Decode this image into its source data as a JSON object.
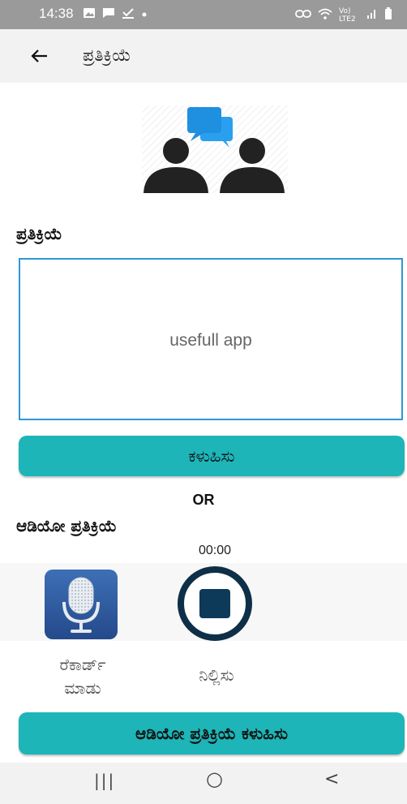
{
  "status_bar": {
    "time": "14:38",
    "left_icons": [
      "gallery-icon",
      "message-icon",
      "download-done-icon",
      "dot-icon"
    ],
    "right_icons": [
      "link-icon",
      "wifi-icon",
      "volte-signal-icon",
      "battery-icon"
    ],
    "network_label": "Vo) LTE2"
  },
  "appbar": {
    "title": "ಪ್ರತಿಕ್ರಿಯೆ"
  },
  "feedback": {
    "heading": "ಪ್ರತಿಕ್ರಿಯೆ",
    "text_value": "usefull app",
    "send_label": "ಕಳುಹಿಸು"
  },
  "or_label": "OR",
  "audio": {
    "heading": "ಆಡಿಯೋ ಪ್ರತಿಕ್ರಿಯೆ",
    "timer": "00:00",
    "record_label_line1": "ರೆಕಾರ್ಡ್",
    "record_label_line2": "ಮಾಡು",
    "stop_label": "ನಿಲ್ಲಿಸು",
    "send_label": "ಆಡಿಯೋ ಪ್ರತಿಕ್ರಿಯೆ ಕಳುಹಿಸು"
  },
  "nav": {
    "recent": "|||",
    "home": "○",
    "back": "<"
  },
  "colors": {
    "accent": "#1db5b8",
    "input_border": "#2f97d6",
    "status_bar": "#9a9a9a",
    "chat_blue": "#1f8fe0",
    "stop_ring": "#0e2f47"
  }
}
